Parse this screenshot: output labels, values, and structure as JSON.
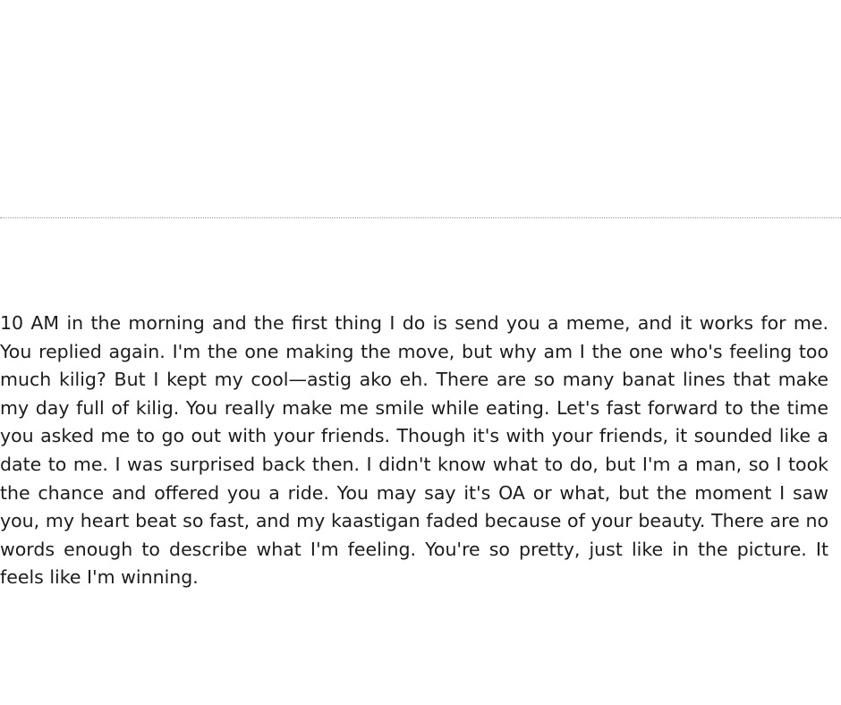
{
  "document": {
    "paragraph": "10 AM in the morning and the first thing I do is send you a meme, and it works for me. You replied again. I'm the one making the move, but why am I the one who's feeling too much kilig? But I kept my cool—astig ako eh. There are so many banat lines that make my day full of kilig. You really make me smile while eating. Let's fast forward to the time you asked me to go out with your friends. Though it's with your friends, it sounded like a date to me. I was surprised back then. I didn't know what to do, but I'm a man, so I took the chance and offered you a ride. You may say it's OA or what, but the moment I saw you, my heart beat so fast, and my kaastigan faded because of your beauty. There are no words enough to describe what I'm feeling. You're so pretty, just like in the picture. It feels like I'm winning."
  },
  "colors": {
    "background": "#ffffff",
    "text": "#1c1c1c",
    "divider": "#9a9a9a"
  }
}
